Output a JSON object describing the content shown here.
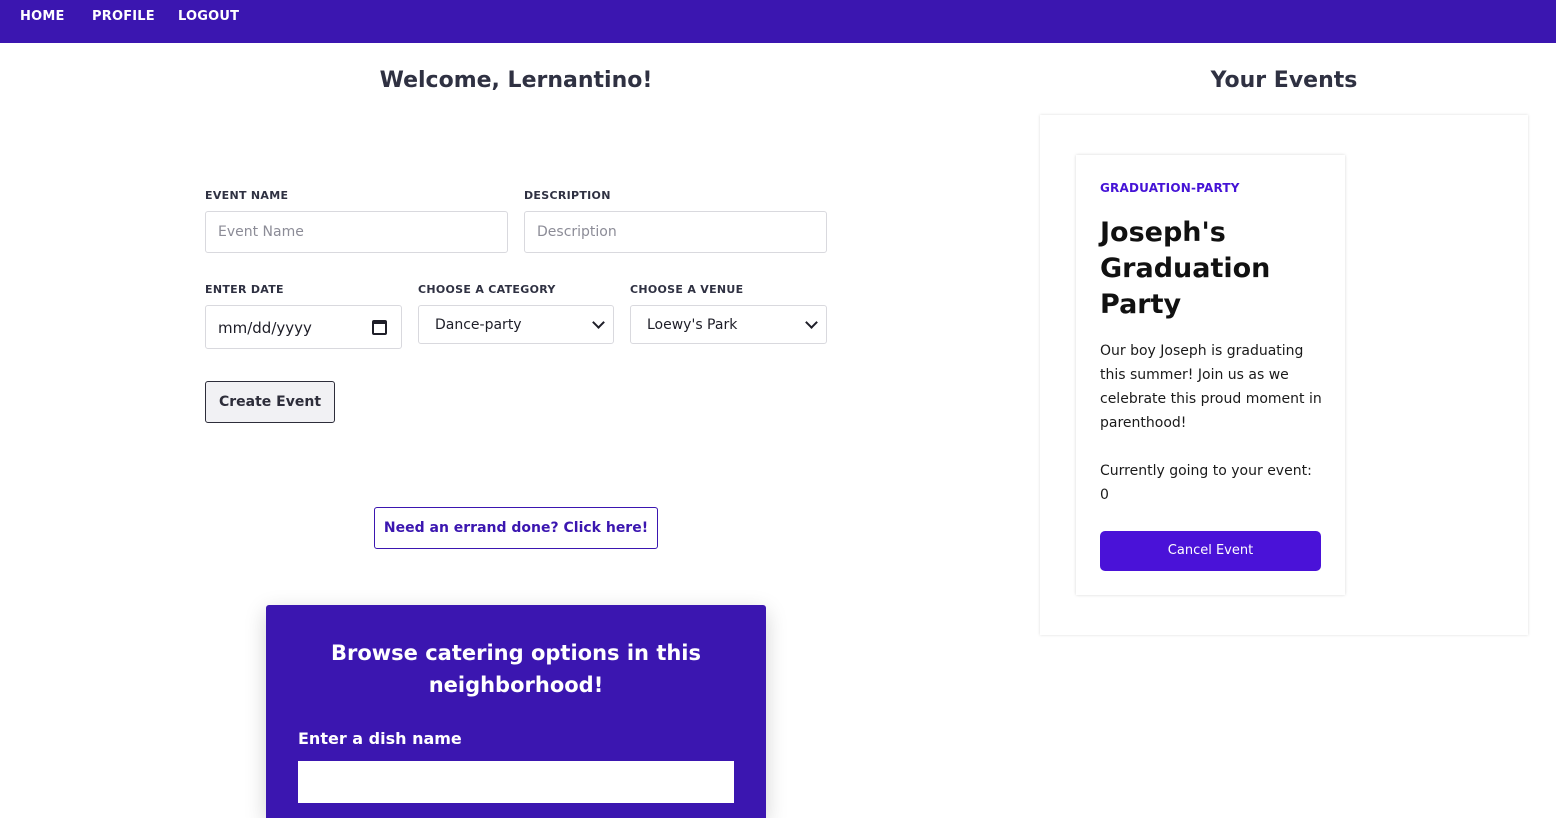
{
  "nav": {
    "items": [
      "HOME",
      "PROFILE",
      "LOGOUT"
    ]
  },
  "welcome": "Welcome, Lernantino!",
  "form": {
    "event_name_label": "EVENT NAME",
    "event_name_placeholder": "Event Name",
    "event_name_value": "",
    "description_label": "DESCRIPTION",
    "description_placeholder": "Description",
    "description_value": "",
    "date_label": "ENTER DATE",
    "date_value": "mm/dd/yyyy",
    "category_label": "CHOOSE A CATEGORY",
    "category_value": "Dance-party",
    "venue_label": "CHOOSE A VENUE",
    "venue_value": "Loewy's Park",
    "create_button": "Create Event"
  },
  "errand_button": "Need an errand done? Click here!",
  "catering": {
    "title": "Browse catering options in this neighborhood!",
    "dish_label": "Enter a dish name",
    "dish_value": ""
  },
  "events": {
    "heading": "Your Events",
    "items": [
      {
        "category": "GRADUATION-PARTY",
        "title": "Joseph's Graduation Party",
        "description": "Our boy Joseph is graduating this summer! Join us as we celebrate this proud moment in parenthood!",
        "going_text": "Currently going to your event: 0",
        "cancel_button": "Cancel Event"
      }
    ]
  },
  "colors": {
    "brand": "#3b16b0",
    "accent": "#4a12d8"
  }
}
